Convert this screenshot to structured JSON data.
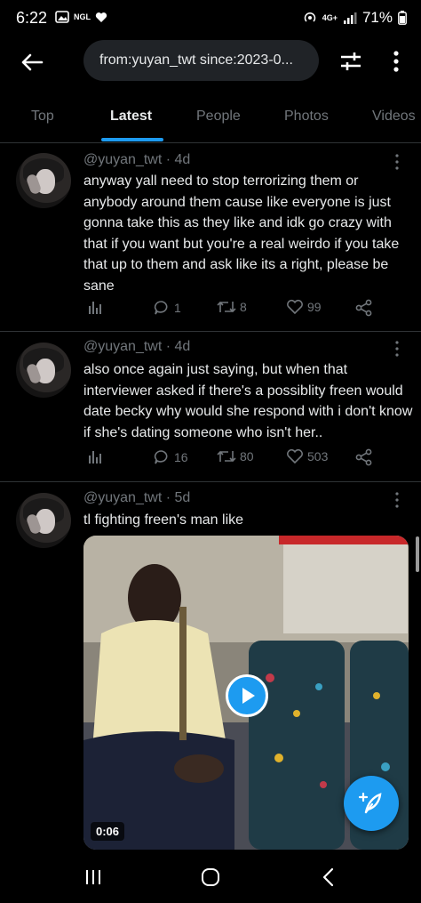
{
  "status_bar": {
    "time": "6:22",
    "app_badge": "NGL",
    "network": "4G+",
    "battery": "71%"
  },
  "search": {
    "query": "from:yuyan_twt since:2023-0..."
  },
  "tabs": [
    {
      "label": "Top"
    },
    {
      "label": "Latest",
      "active": true
    },
    {
      "label": "People"
    },
    {
      "label": "Photos"
    },
    {
      "label": "Videos"
    }
  ],
  "tweets": [
    {
      "handle_line": "@yuyan_twt · 4d",
      "text": "anyway yall need to stop terrorizing them or anybody around them cause like everyone is just gonna take this as they like and idk go crazy with that if you want but you're a real weirdo if you take that up to them and ask like its a right, please be sane",
      "replies": "1",
      "retweets": "8",
      "likes": "99"
    },
    {
      "handle_line": "@yuyan_twt · 4d",
      "text": "also once again just saying, but when that interviewer asked if there's a possiblity freen would date becky why would she respond with i don't know if she's dating someone who isn't her..",
      "replies": "16",
      "retweets": "80",
      "likes": "503"
    },
    {
      "handle_line": "@yuyan_twt · 5d",
      "text": "tl fighting freen's man like",
      "video_duration": "0:06"
    }
  ],
  "colors": {
    "accent": "#1d9bf0",
    "background": "#000000",
    "muted_text": "#71767b",
    "divider": "#2f3336"
  }
}
